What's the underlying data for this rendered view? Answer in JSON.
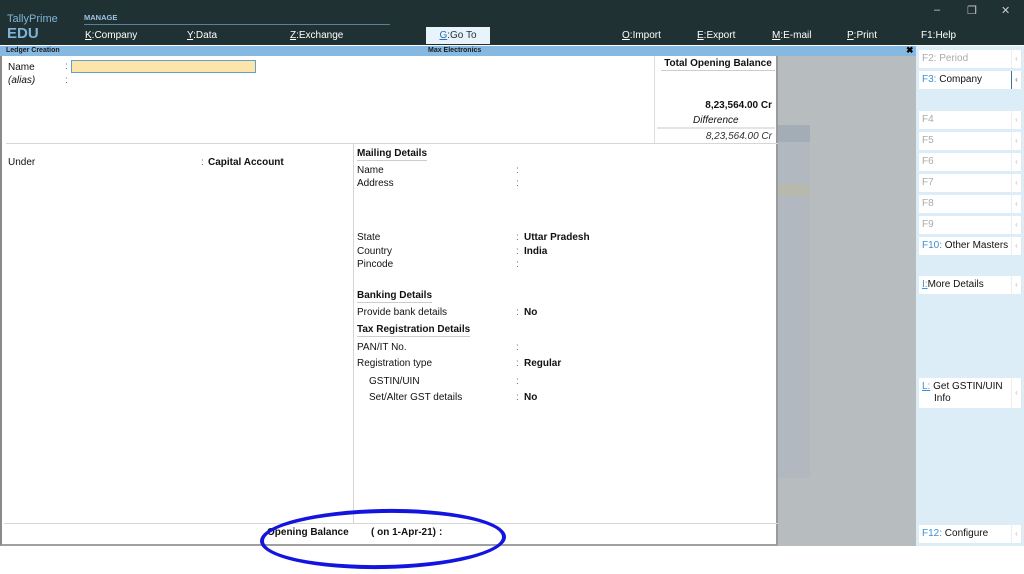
{
  "app": {
    "name": "TallyPrime",
    "edition": "EDU"
  },
  "topbar": {
    "section_label": "MANAGE",
    "menu": [
      {
        "key": "K",
        "label": "Company"
      },
      {
        "key": "Y",
        "label": "Data"
      },
      {
        "key": "Z",
        "label": "Exchange"
      },
      {
        "key": "G",
        "label": "Go To"
      },
      {
        "key": "O",
        "label": "Import"
      },
      {
        "key": "E",
        "label": "Export"
      },
      {
        "key": "M",
        "label": "E-mail"
      },
      {
        "key": "P",
        "label": "Print"
      },
      {
        "key": "F1",
        "label": "Help"
      }
    ],
    "window_controls": {
      "minimize": "–",
      "restore": "❐",
      "close": "✕"
    }
  },
  "titlebar": {
    "screen": "Ledger Creation",
    "company": "Max Electronics",
    "close": "✖"
  },
  "form": {
    "name_label": "Name",
    "name_value": "",
    "alias_label": "(alias)",
    "under_label": "Under",
    "under_value": "Capital Account",
    "colon": ":",
    "total_opening": {
      "title": "Total Opening Balance",
      "amount": "8,23,564.00 Cr",
      "difference_label": "Difference",
      "difference_amount": "8,23,564.00 Cr"
    },
    "mailing": {
      "title": "Mailing Details",
      "name_label": "Name",
      "address_label": "Address",
      "state_label": "State",
      "state_value": "Uttar Pradesh",
      "country_label": "Country",
      "country_value": "India",
      "pincode_label": "Pincode"
    },
    "banking": {
      "title": "Banking Details",
      "provide_label": "Provide bank details",
      "provide_value": "No"
    },
    "tax": {
      "title": "Tax Registration Details",
      "pan_label": "PAN/IT No.",
      "regtype_label": "Registration type",
      "regtype_value": "Regular",
      "gstin_label": "GSTIN/UIN",
      "setalter_label": "Set/Alter GST details",
      "setalter_value": "No"
    },
    "opening_balance": {
      "label": "Opening Balance",
      "date": "( on 1-Apr-21)",
      "colon": ":"
    }
  },
  "sidebar": {
    "buttons": [
      {
        "key": "F2:",
        "label": "Period",
        "enabled": false
      },
      {
        "key": "F3:",
        "label": "Company",
        "enabled": true
      },
      {
        "key": "F4",
        "label": "",
        "enabled": false
      },
      {
        "key": "F5",
        "label": "",
        "enabled": false
      },
      {
        "key": "F6",
        "label": "",
        "enabled": false
      },
      {
        "key": "F7",
        "label": "",
        "enabled": false
      },
      {
        "key": "F8",
        "label": "",
        "enabled": false
      },
      {
        "key": "F9",
        "label": "",
        "enabled": false
      },
      {
        "key": "F10:",
        "label": "Other Masters",
        "enabled": true
      },
      {
        "key": "I:",
        "label": "More Details",
        "enabled": true
      },
      {
        "key": "L:",
        "label": "Get GSTIN/UIN Info",
        "enabled": true
      },
      {
        "key": "F12:",
        "label": "Configure",
        "enabled": true
      }
    ],
    "arrow": "‹"
  }
}
